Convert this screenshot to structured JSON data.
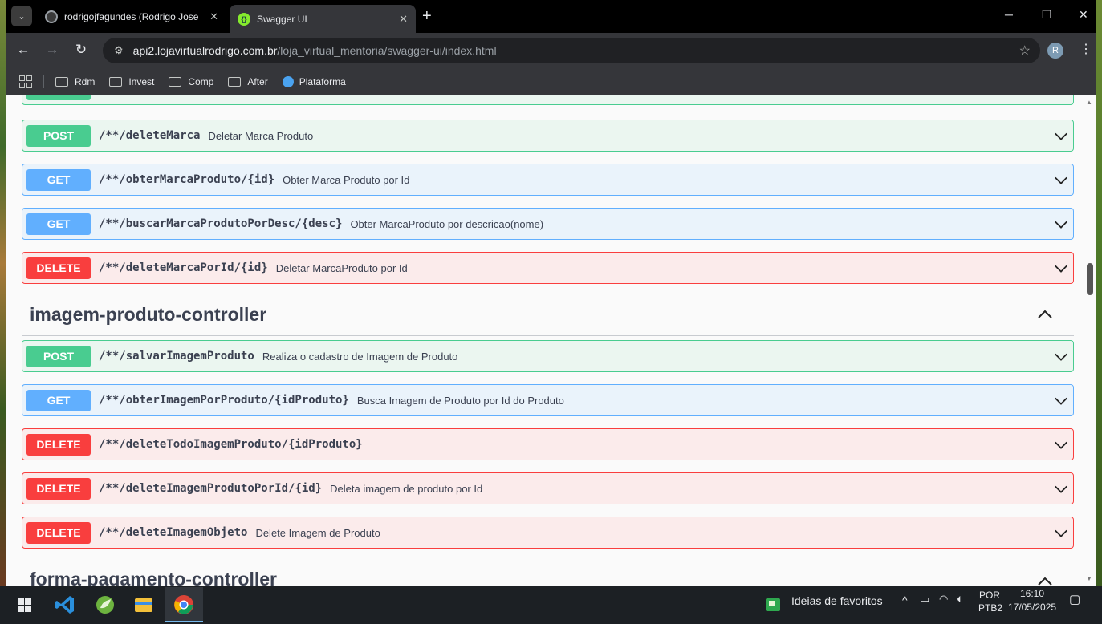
{
  "browser": {
    "tabs": [
      {
        "title": "rodrigojfagundes (Rodrigo Jose",
        "icon": "github-icon",
        "active": false
      },
      {
        "title": "Swagger UI",
        "icon": "swagger-icon",
        "active": true
      }
    ],
    "address": {
      "host": "api2.lojavirtualrodrigo.com.br",
      "path": "/loja_virtual_mentoria/swagger-ui/index.html"
    },
    "profile_initial": "R",
    "bookmarks": [
      "Rdm",
      "Invest",
      "Comp",
      "After",
      "Plataforma"
    ]
  },
  "operations": [
    {
      "method": "POST",
      "path": "/**/deleteMarca",
      "summary": "Deletar Marca Produto"
    },
    {
      "method": "GET",
      "path": "/**/obterMarcaProduto/{id}",
      "summary": "Obter Marca Produto por Id"
    },
    {
      "method": "GET",
      "path": "/**/buscarMarcaProdutoPorDesc/{desc}",
      "summary": "Obter MarcaProduto por descricao(nome)"
    },
    {
      "method": "DELETE",
      "path": "/**/deleteMarcaPorId/{id}",
      "summary": "Deletar MarcaProduto por Id"
    }
  ],
  "section": {
    "title": "imagem-produto-controller",
    "operations": [
      {
        "method": "POST",
        "path": "/**/salvarImagemProduto",
        "summary": "Realiza o cadastro de Imagem de Produto"
      },
      {
        "method": "GET",
        "path": "/**/obterImagemPorProduto/{idProduto}",
        "summary": "Busca Imagem de Produto por Id do Produto"
      },
      {
        "method": "DELETE",
        "path": "/**/deleteTodoImagemProduto/{idProduto}",
        "summary": ""
      },
      {
        "method": "DELETE",
        "path": "/**/deleteImagemProdutoPorId/{id}",
        "summary": "Deleta imagem de produto por Id"
      },
      {
        "method": "DELETE",
        "path": "/**/deleteImagemObjeto",
        "summary": "Delete Imagem de Produto"
      }
    ]
  },
  "next_section": {
    "title": "forma-pagamento-controller"
  },
  "taskbar": {
    "notification": "Ideias de favoritos",
    "lang_top": "POR",
    "lang_bottom": "PTB2",
    "time": "16:10",
    "date": "17/05/2025"
  },
  "colors": {
    "post": "#49cc90",
    "get": "#61affe",
    "delete": "#f93e3e"
  }
}
